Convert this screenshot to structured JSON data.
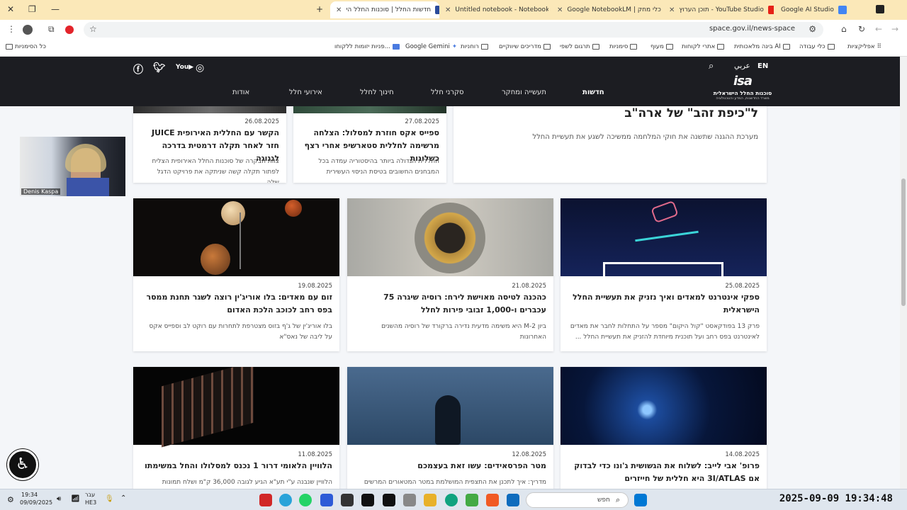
{
  "browser": {
    "tabs": [
      {
        "title": "Google AI Studio"
      },
      {
        "title": "תוכן הערוץ - YouTube Studio"
      },
      {
        "title": "Google NotebookLM | כלי מחק"
      },
      {
        "title": "Untitled notebook - NotebookL"
      },
      {
        "title": "חדשות החלל | סוכנות החלל הי"
      }
    ],
    "url": "space.gov.il/news-space",
    "bookmarks": [
      {
        "label": "אפליקציות"
      },
      {
        "label": "כלי עבודה"
      },
      {
        "label": "בינה מלאכותית AI"
      },
      {
        "label": "אתרי לקוחות"
      },
      {
        "label": "מעוף"
      },
      {
        "label": "סימניות"
      },
      {
        "label": "תרגום לשפי"
      },
      {
        "label": "מדריכים שיווקיים"
      },
      {
        "label": "רוחניות"
      },
      {
        "label": "Google Gemini"
      },
      {
        "label": "פניות יזומות ללקוחו..."
      },
      {
        "label": "כל הסימניות"
      }
    ]
  },
  "site": {
    "lang_en": "EN",
    "lang_ar": "عربي",
    "nav": [
      "חדשות",
      "תעשייה ומחקר",
      "סקרני חלל",
      "חינוך לחלל",
      "אירועי חלל",
      "אודות"
    ],
    "logo_name": "סוכנות החלל הישראלית",
    "logo_sub": "משרד החדשנות, המדע והטכנולוגיה",
    "featured": {
      "title": "ל\"כיפת זהב\" של ארה\"ב",
      "desc": "מערכת ההגנה שתשנה את חוקי המלחמה ממשיכה לשגע את תעשיית החלל"
    },
    "cards_row1": [
      {
        "date": "27.08.2025",
        "title": "ספייס אקס חוזרת למסלול: הצלחה מרשימה לחללית סטארשיפ אחרי רצף כשלונות",
        "desc": "החללית הגדולה ביותר בהיסטוריה עמדה בכל המבחנים החשובים בטיסת הניסוי העשירית"
      },
      {
        "date": "26.08.2025",
        "title": "הקשר עם החללית האירופית JUICE חזר לאחר תקלה דרמטית בדרכה לגנוגה",
        "desc": "צוות הבקרה של סוכנות החלל האירופית הצליח לפתור תקלה קשה שניתקה את פרויקט הדגל שלה..."
      }
    ],
    "cards_row2": [
      {
        "date": "25.08.2025",
        "title": "ספקי אינטרנט למאדים ואיך נזניק את תעשיית החלל הישראלית",
        "desc": "פרק 13 בפודקאסט \"קול היקום\" מספר על התחלות לחבר את מאדים לאינטרנט בפס רחב ועל תוכנית מיוחדת להזניק את תעשיית החלל ..."
      },
      {
        "date": "21.08.2025",
        "title": "כהכנה לטיסה מאוישת לירח: רוסיה שיגרה 75 עכברים ו-1,000 זבובי פירות לחלל",
        "desc": "ביון M-2 היא משימה מדעית נדירה ברקורד של רוסיה מהשנים האחרונות"
      },
      {
        "date": "19.08.2025",
        "title": "זום עם מאדים: בלו אוריג'ין רוצה לשגר תחנת ממסר בפס רחב לכוכב הלכת האדום",
        "desc": "בלו אוריג'ין של ג'ף בזוס מצטרפת לתחרות עם רוקט לב וספייס אקס על ליבה של נאס\"א"
      }
    ],
    "cards_row3": [
      {
        "date": "14.08.2025",
        "title": "פרופ' אבי לייב: לשלוח את הגשושית ג'ונו כדי לבדוק אם 3I/ATLAS היא חללית של חייזרים",
        "desc": ""
      },
      {
        "date": "12.08.2025",
        "title": "מטר הפרסאידים: עשו זאת בעצמכם",
        "desc": "מדריך: איך לתכנן את התצפית המושלמת במטר המטאורים המרשים"
      },
      {
        "date": "11.08.2025",
        "title": "הלוויין הלאומי דרור 1 נכנס למסלולו והחל במשימתו",
        "desc": "הלוויין שנבנה ע\"י תע\"א הגיע לגובה 36,000 ק\"מ ושלח תמונות"
      }
    ]
  },
  "overlay": {
    "webcam_name": "Denis Kaspa"
  },
  "taskbar": {
    "time_small": "19:34",
    "date_small": "09/09/2025",
    "lang": "עבר",
    "lang2": "HE3",
    "search_placeholder": "חפש",
    "big_clock": "2025-09-09  19:34:48"
  }
}
